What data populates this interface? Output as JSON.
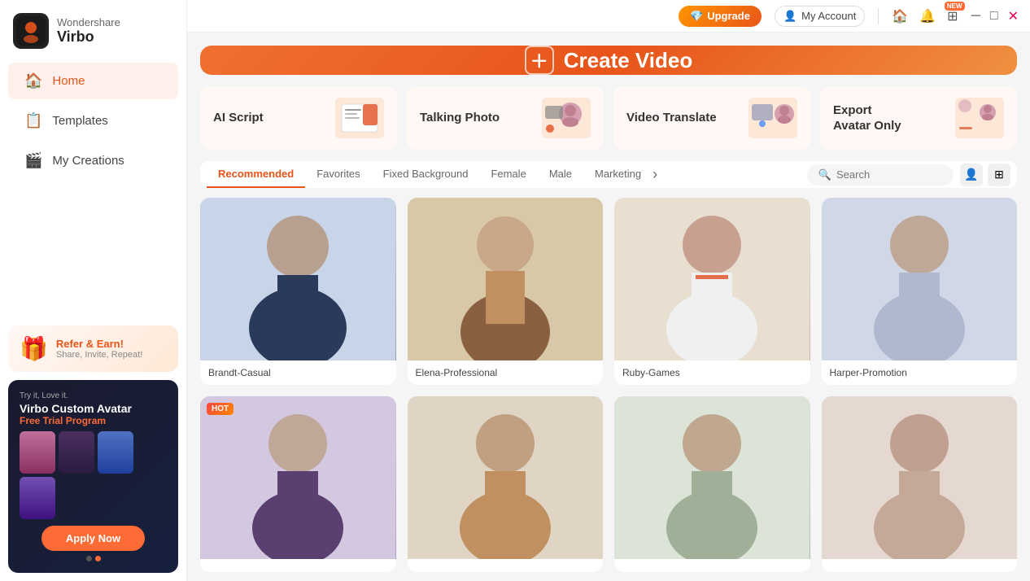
{
  "app": {
    "brand": "Wondershare",
    "product": "Virbo"
  },
  "titlebar": {
    "upgrade_label": "Upgrade",
    "account_label": "My Account",
    "new_badge": "NEW"
  },
  "sidebar": {
    "nav": [
      {
        "id": "home",
        "label": "Home",
        "active": true
      },
      {
        "id": "templates",
        "label": "Templates",
        "active": false
      },
      {
        "id": "my-creations",
        "label": "My Creations",
        "active": false
      }
    ],
    "refer": {
      "title": "Refer & Earn!",
      "subtitle": "Share, Invite, Repeat!"
    },
    "promo": {
      "tagline": "Try it, Love it.",
      "brand": "Virbo Custom Avatar",
      "subtitle": "",
      "highlight": "Free Trial Program",
      "apply_label": "Apply Now"
    }
  },
  "banner": {
    "label": "Create Video"
  },
  "features": [
    {
      "id": "ai-script",
      "title": "AI Script"
    },
    {
      "id": "talking-photo",
      "title": "Talking Photo"
    },
    {
      "id": "video-translate",
      "title": "Video Translate"
    },
    {
      "id": "export-avatar",
      "title": "Export\nAvatar Only"
    }
  ],
  "tabs": [
    {
      "id": "recommended",
      "label": "Recommended",
      "active": true
    },
    {
      "id": "favorites",
      "label": "Favorites",
      "active": false
    },
    {
      "id": "fixed-background",
      "label": "Fixed Background",
      "active": false
    },
    {
      "id": "female",
      "label": "Female",
      "active": false
    },
    {
      "id": "male",
      "label": "Male",
      "active": false
    },
    {
      "id": "marketing",
      "label": "Marketing",
      "active": false
    }
  ],
  "search": {
    "placeholder": "Search"
  },
  "avatars": [
    {
      "id": 1,
      "name": "Brandt-Casual",
      "hot": false,
      "row": 1
    },
    {
      "id": 2,
      "name": "Elena-Professional",
      "hot": false,
      "row": 1
    },
    {
      "id": 3,
      "name": "Ruby-Games",
      "hot": false,
      "row": 1
    },
    {
      "id": 4,
      "name": "Harper-Promotion",
      "hot": false,
      "row": 1
    },
    {
      "id": 5,
      "name": "",
      "hot": true,
      "row": 2
    },
    {
      "id": 6,
      "name": "",
      "hot": false,
      "row": 2
    },
    {
      "id": 7,
      "name": "",
      "hot": false,
      "row": 2
    },
    {
      "id": 8,
      "name": "",
      "hot": false,
      "row": 2
    }
  ]
}
